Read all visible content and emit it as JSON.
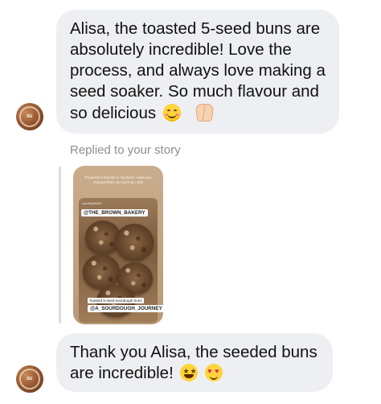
{
  "messages": [
    {
      "text": "Alisa, the toasted 5-seed buns are absolutely incredible! Love the process, and always love making a seed soaker. So much flavour and so delicious",
      "emojis": [
        "smiling-face-emoji",
        "folded-hands-emoji"
      ]
    },
    {
      "text": "Thank you Alisa, the seeded buns are incredible!",
      "emojis": [
        "star-struck-emoji",
        "heart-eyes-emoji"
      ]
    }
  ],
  "reply_label": "Replied to your story",
  "story": {
    "caption": "Prepared a favorite in my Bowl. Hope you enjoyed them as much as I did!",
    "user": "courtney8042",
    "tag_top": "@THE_BROWN_BAKERY",
    "photo_caption": "Toasted 5-seed sourdough buns",
    "tag_bottom": "@A_SOURDOUGH_JOURNEY"
  },
  "avatar_label": "BE",
  "colors": {
    "bubble": "#eeeff2",
    "muted_text": "#8e8e93",
    "story_background": "#c9ad8c"
  }
}
